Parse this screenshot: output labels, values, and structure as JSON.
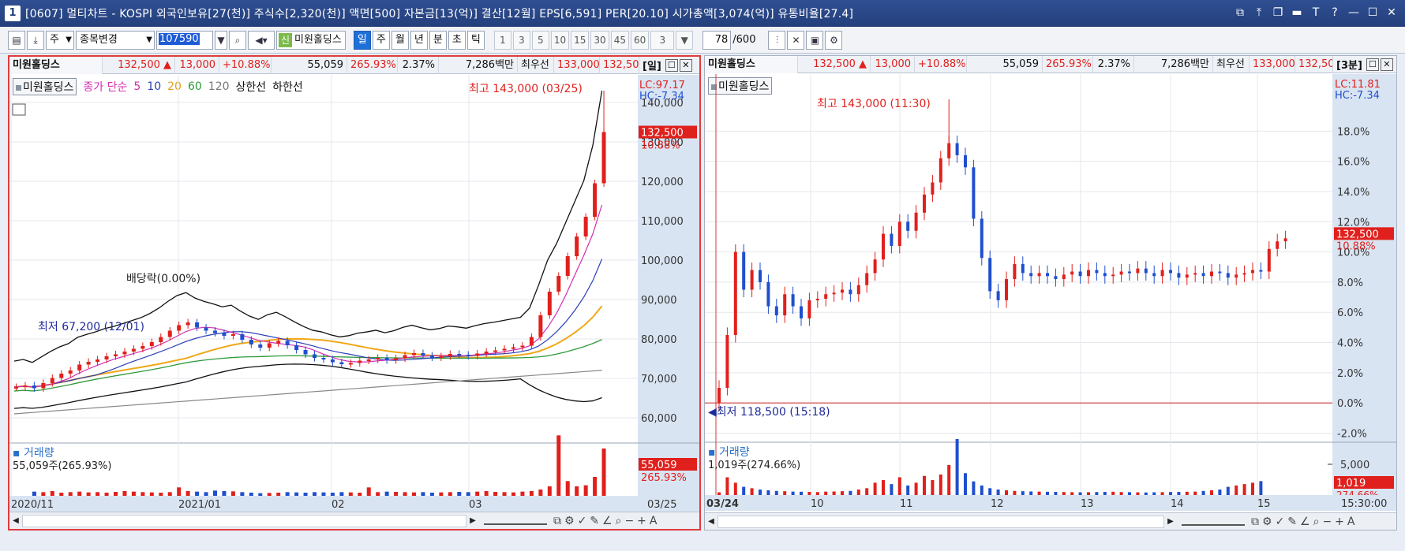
{
  "window": {
    "number": "1",
    "title": "[0607] 멀티차트 - KOSPI 외국인보유[27(천)] 주식수[2,320(천)] 액면[500] 자본금[13(억)] 결산[12월] EPS[6,591] PER[20.10] 시가총액[3,074(억)] 유통비율[27.4]",
    "controls": [
      "⧉",
      "⤒",
      "❐",
      "▬",
      "T",
      "?",
      "—",
      "☐",
      "✕"
    ]
  },
  "toolbar": {
    "stock_type": "주",
    "change_combo": "종목변경",
    "code": "107590",
    "new_badge": "신",
    "stock_name": "미원홀딩스",
    "periods": [
      "일",
      "주",
      "월",
      "년",
      "분",
      "초",
      "틱"
    ],
    "active_period": "일",
    "minute_values": [
      "1",
      "3",
      "5",
      "10",
      "15",
      "30",
      "45",
      "60"
    ],
    "minute_selected": "3",
    "count": "78",
    "count_max": "/600"
  },
  "left": {
    "info": {
      "name": "미원홀딩스",
      "price": "132,500 ▲",
      "change": "13,000",
      "rate": "+10.88%",
      "volume": "55,059",
      "vol_rate": "265.93%",
      "turnover": "2.37%",
      "amount": "7,286백만",
      "best_label": "최우선",
      "best_ask": "133,000",
      "best_bid": "132,500",
      "period": "[일]"
    },
    "legend": {
      "name": "미원홀딩스",
      "ma_label": "종가 단순",
      "ma5": "5",
      "ma10": "10",
      "ma20": "20",
      "ma60": "60",
      "ma120": "120",
      "upper": "상한선",
      "lower": "하한선"
    },
    "lc": "LC:97.17",
    "hc": "HC:-7.34",
    "high_note": "최고 143,000 (03/25)",
    "low_note": "최저 67,200 (12/01)",
    "dividend_note": "배당락(0.00%)",
    "price_tag": "132,500",
    "price_rate": "10.88%",
    "volume_title": "거래량",
    "volume_note": "55,059주(265.93%)",
    "volume_tag": "55,059",
    "volume_rate": "265.93%",
    "dates": [
      "2020/11",
      "2021/01",
      "02",
      "03",
      "03/25"
    ]
  },
  "right": {
    "info": {
      "name": "미원홀딩스",
      "price": "132,500 ▲",
      "change": "13,000",
      "rate": "+10.88%",
      "volume": "55,059",
      "vol_rate": "265.93%",
      "turnover": "2.37%",
      "amount": "7,286백만",
      "best_label": "최우선",
      "best_ask": "133,000",
      "best_bid": "132,500",
      "period": "[3분]"
    },
    "legend": {
      "name": "미원홀딩스"
    },
    "lc": "LC:11.81",
    "hc": "HC:-7.34",
    "high_note": "최고 143,000 (11:30)",
    "low_note": "최저 118,500 (15:18)",
    "price_tag": "132,500",
    "price_rate": "10.88%",
    "volume_title": "거래량",
    "volume_note": "1,019주(274.66%)",
    "volume_tag": "1,019",
    "volume_rate": "274.66%",
    "dates": [
      "03/24",
      "10",
      "11",
      "12",
      "13",
      "14",
      "15",
      "15:30:00"
    ]
  },
  "chart_data": [
    {
      "type": "candlestick",
      "title": "미원홀딩스 일봉",
      "y_ticks": [
        "140,000",
        "130,000",
        "120,000",
        "110,000",
        "100,000",
        "90,000",
        "80,000",
        "70,000",
        "60,000"
      ],
      "ylim": [
        55000,
        145000
      ],
      "closes": [
        67800,
        68200,
        67500,
        68800,
        70100,
        71200,
        72000,
        73500,
        74200,
        74800,
        75600,
        76100,
        76800,
        77500,
        78200,
        79200,
        80500,
        82100,
        83500,
        84200,
        82900,
        82100,
        81500,
        80800,
        81200,
        79800,
        78600,
        77800,
        78900,
        79500,
        78400,
        77200,
        76100,
        75200,
        74800,
        74100,
        73600,
        73900,
        74500,
        74800,
        75200,
        74600,
        75100,
        75900,
        76400,
        75800,
        75300,
        75600,
        76200,
        76000,
        75700,
        76300,
        76800,
        77100,
        77500,
        77900,
        78300,
        80500,
        86000,
        92000,
        96000,
        101000,
        106000,
        111000,
        119500,
        132500
      ],
      "volume_ticks": [],
      "volumes": [
        800,
        700,
        900,
        600,
        700,
        800,
        650,
        700,
        600,
        750,
        900,
        800,
        700,
        650,
        600,
        700,
        1600,
        900,
        800,
        700,
        1000,
        900,
        850,
        700,
        600,
        500,
        550,
        600,
        700,
        650,
        600,
        700,
        650,
        600,
        700,
        650,
        600,
        1600,
        700,
        800,
        750,
        700,
        650,
        700,
        600,
        650,
        700,
        750,
        700,
        800,
        900,
        750,
        700,
        650,
        800,
        900,
        1200,
        1800,
        11500,
        2800,
        1800,
        2000,
        3600,
        9000
      ]
    },
    {
      "type": "candlestick",
      "title": "미원홀딩스 3분봉",
      "y_ticks": [
        "18.0%",
        "16.0%",
        "14.0%",
        "12.0%",
        "10.0%",
        "8.0%",
        "6.0%",
        "4.0%",
        "2.0%",
        "0.0%",
        "-2.0%"
      ],
      "ylim": [
        -2.6,
        20
      ],
      "rates": [
        1.0,
        4.5,
        10.0,
        7.5,
        8.8,
        8.0,
        6.4,
        5.8,
        7.2,
        6.4,
        5.6,
        6.8,
        6.9,
        7.2,
        7.3,
        7.5,
        7.2,
        7.8,
        8.6,
        9.5,
        11.2,
        10.4,
        12.0,
        11.4,
        12.6,
        13.8,
        14.6,
        16.2,
        17.2,
        16.4,
        15.6,
        12.2,
        9.6,
        7.4,
        6.8,
        8.2,
        9.2,
        8.6,
        8.4,
        8.6,
        8.4,
        8.2,
        8.5,
        8.7,
        8.4,
        8.8,
        8.6,
        8.4,
        8.5,
        8.7,
        8.6,
        8.9,
        8.6,
        8.4,
        8.8,
        8.6,
        8.3,
        8.5,
        8.6,
        8.4,
        8.7,
        8.6,
        8.3,
        8.5,
        8.6,
        8.8,
        8.7,
        10.2,
        10.7,
        10.9
      ],
      "volumes": [
        200,
        1300,
        900,
        600,
        500,
        400,
        350,
        300,
        280,
        250,
        240,
        230,
        220,
        250,
        260,
        280,
        300,
        400,
        500,
        900,
        1100,
        800,
        1300,
        700,
        900,
        1400,
        1100,
        1500,
        2200,
        4100,
        1600,
        1000,
        700,
        500,
        400,
        350,
        300,
        280,
        260,
        250,
        240,
        230,
        220,
        210,
        200,
        210,
        220,
        230,
        240,
        220,
        210,
        200,
        190,
        200,
        210,
        220,
        230,
        240,
        250,
        300,
        350,
        400,
        600,
        700,
        800,
        900,
        1019
      ]
    }
  ]
}
